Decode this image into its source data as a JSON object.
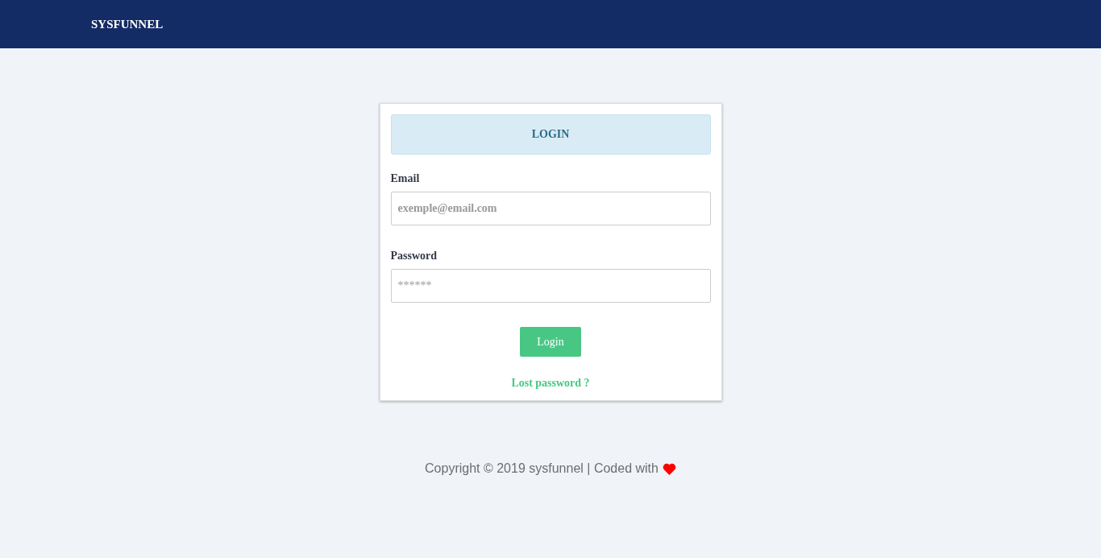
{
  "navbar": {
    "brand": "SYSFUNNEL"
  },
  "login_card": {
    "title": "LOGIN",
    "fields": [
      {
        "label": "Email",
        "placeholder": "exemple@email.com",
        "kind": "email"
      },
      {
        "label": "Password",
        "placeholder": "******",
        "kind": "password"
      }
    ],
    "button": "Login",
    "link": "Lost password ?"
  },
  "footer": {
    "text": "Copyright © 2019 sysfunnel | Coded with"
  }
}
